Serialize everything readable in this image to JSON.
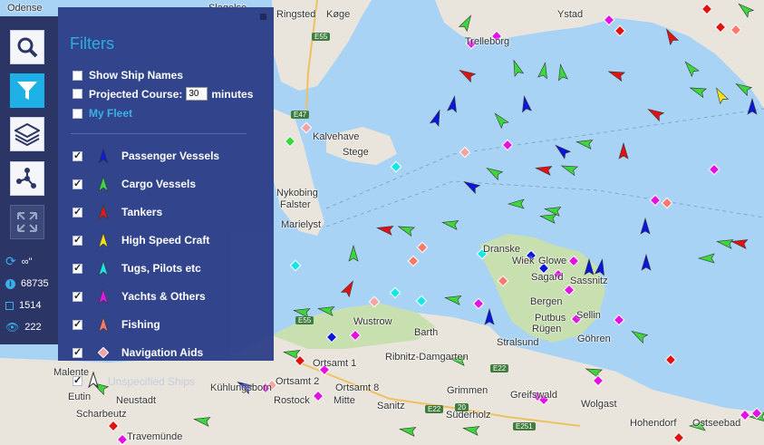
{
  "filters_panel": {
    "title": "Filters",
    "show_ship_names": "Show Ship Names",
    "projected_course_label": "Projected Course:",
    "projected_course_value": "30",
    "projected_course_unit": "minutes",
    "my_fleet": "My Fleet",
    "legend": [
      {
        "label": "Passenger Vessels",
        "color": "#0a16d8"
      },
      {
        "label": "Cargo Vessels",
        "color": "#3ed63e"
      },
      {
        "label": "Tankers",
        "color": "#e01313"
      },
      {
        "label": "High Speed Craft",
        "color": "#f3e313"
      },
      {
        "label": "Tugs, Pilots etc",
        "color": "#17e6e6"
      },
      {
        "label": "Yachts & Others",
        "color": "#e312e3"
      },
      {
        "label": "Fishing",
        "color": "#f77a6a"
      },
      {
        "label": "Navigation Aids",
        "color": "#f3a3a3"
      }
    ],
    "unspecified": "Unspecified Ships"
  },
  "sidebar": {
    "buttons": [
      {
        "name": "search-button",
        "icon": "search-icon"
      },
      {
        "name": "filter-button",
        "icon": "funnel-icon"
      },
      {
        "name": "layers-button",
        "icon": "layers-icon"
      },
      {
        "name": "network-button",
        "icon": "network-icon"
      },
      {
        "name": "fullscreen-button",
        "icon": "expand-icon"
      }
    ],
    "refresh_value": "∞\"",
    "info_count": "68735",
    "square_count": "1514",
    "eye_count": "222"
  },
  "map_labels": [
    "Odense",
    "Slagelse",
    "Ringsted",
    "Køge",
    "Trelleborg",
    "Ystad",
    "Kalvehave",
    "Stege",
    "Nykobing",
    "Falster",
    "Marielyst",
    "Dranske",
    "Wiek",
    "Glowe",
    "Sagard",
    "Sassnitz",
    "Bergen",
    "Sellin",
    "Putbus",
    "Rügen",
    "Göhren",
    "Wustrow",
    "Barth",
    "Stralsund",
    "Ribnitz-Damgarten",
    "Ortsamt 1",
    "Ortsamt 2",
    "Ortsamt 8",
    "Kühlungsborn",
    "Rostock",
    "Mitte",
    "Sanitz",
    "Grimmen",
    "Süderholz",
    "Greifswald",
    "Wolgast",
    "Hohendorf",
    "Ostseebad",
    "Malente",
    "Eutin",
    "Neustadt",
    "Scharbeutz",
    "Travemünde",
    "E55",
    "E47",
    "E22",
    "E22",
    "E251",
    "20",
    "E55"
  ],
  "colors": {
    "sea": "#a9d3f5",
    "land": "#e9e5dc",
    "green_land": "#c8dfb0",
    "panel_bg": "#2f4189",
    "sidebar_bg": "#2b3566",
    "accent": "#2aabe4"
  }
}
